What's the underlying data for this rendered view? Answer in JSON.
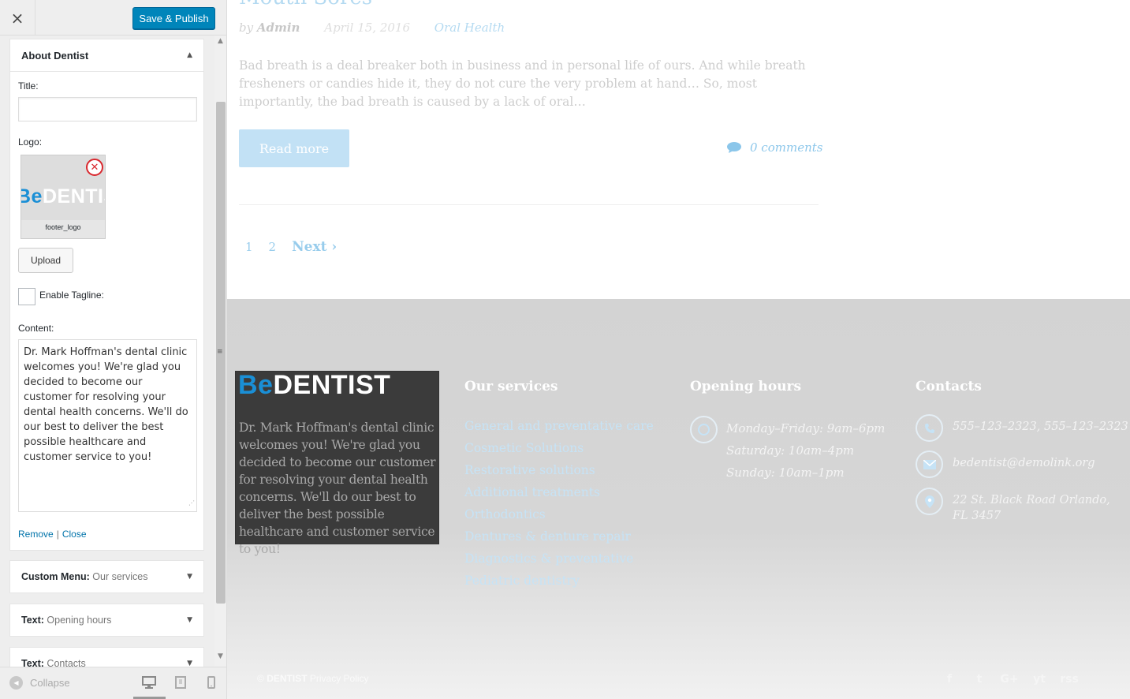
{
  "sidebar": {
    "close_label": "×",
    "save_button": "Save & Publish",
    "widget_open": {
      "title": "About Dentist",
      "title_label": "Title:",
      "title_value": "",
      "logo_label": "Logo:",
      "logo_thumb_be": "Be",
      "logo_thumb_rest": "DENTIST",
      "logo_filename": "footer_logo",
      "upload_button": "Upload",
      "tagline_label": "Enable Tagline:",
      "content_label": "Content:",
      "content_value": "Dr. Mark Hoffman's dental clinic welcomes you! We're glad you decided to become our customer for resolving your dental health concerns. We'll do our best to deliver the best possible healthcare and customer service to you!",
      "remove_link": "Remove",
      "action_sep": "|",
      "close_link": "Close"
    },
    "widgets_closed": [
      {
        "type": "Custom Menu:",
        "name": "Our services"
      },
      {
        "type": "Text:",
        "name": "Opening hours"
      },
      {
        "type": "Text:",
        "name": "Contacts"
      }
    ],
    "collapse_label": "Collapse"
  },
  "preview": {
    "post": {
      "title": "Mouth Sores",
      "by": "by",
      "author": "Admin",
      "date": "April 15, 2016",
      "category": "Oral Health",
      "excerpt": "Bad breath is a deal breaker both in business and in personal life of ours. And while breath fresheners or candies hide it, they do not cure the very problem at hand… So, most importantly, the bad breath is caused by a lack of oral…",
      "read_more": "Read more",
      "comments": "0 comments"
    },
    "pagination": {
      "pages": [
        "1",
        "2"
      ],
      "next": "Next"
    },
    "footer": {
      "logo_be": "Be",
      "logo_rest": "DENTIST",
      "about_text": "Dr. Mark Hoffman's dental clinic welcomes you! We're glad you decided to become our customer for resolving your dental health concerns. We'll do our best to deliver the best possible healthcare and customer service to you!",
      "services_title": "Our services",
      "services": [
        "General and preventative care",
        "Cosmetic Solutions",
        "Restorative solutions",
        "Additional treatments",
        "Orthodontics",
        "Dentures & denture repair",
        "Diagnostics & preventative",
        "Pediatric dentistry"
      ],
      "hours_title": "Opening hours",
      "hours": [
        "Monday–Friday: 9am–6pm",
        "Saturday: 10am–4pm",
        "Sunday: 10am–1pm"
      ],
      "contacts_title": "Contacts",
      "phone": "555–123–2323, 555–123–2323",
      "email": "bedentist@demolink.org",
      "address": "22 St. Black Road Orlando, FL 3457",
      "copyright_prefix": "©",
      "copyright_brand": "DENTIST",
      "copyright_suffix": "Privacy Policy",
      "social": [
        "f",
        "t",
        "G+",
        "yt",
        "rss"
      ]
    }
  },
  "colors": {
    "accent": "#1a8fd6",
    "wp_button": "#0085ba",
    "remove_red": "#d9282e"
  }
}
